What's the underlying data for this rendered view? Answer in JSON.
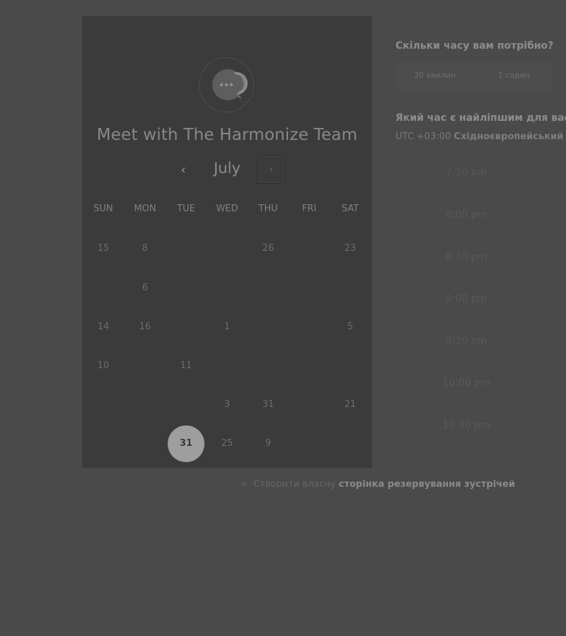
{
  "card": {
    "title": "Meet with The Harmonize Team",
    "month": "July",
    "prev_icon": "‹",
    "next_icon": "›"
  },
  "weekdays": [
    "SUN",
    "MON",
    "TUE",
    "WED",
    "THU",
    "FRI",
    "SAT"
  ],
  "calendar_rows": [
    [
      "15",
      "8",
      "",
      "",
      "26",
      "",
      "23"
    ],
    [
      "",
      "6",
      "",
      "",
      "",
      "",
      ""
    ],
    [
      "14",
      "16",
      "",
      "1",
      "",
      "",
      "5"
    ],
    [
      "10",
      "",
      "11",
      "",
      "",
      "",
      ""
    ],
    [
      "",
      "",
      "",
      "3",
      "31",
      "",
      "21"
    ],
    [
      "",
      "",
      "31",
      "25",
      "9",
      "",
      ""
    ]
  ],
  "selected_day": "31",
  "booking": {
    "duration_question": "Скільки часу вам потрібно?",
    "durations": [
      "30 хвилин",
      "1 годин"
    ],
    "time_question": "Який час є найліпшим для вас?",
    "timezone_offset": "UTC +03:00",
    "timezone_name": "Східноєвропейський час",
    "slots": [
      "7:30 pm",
      "8:00 pm",
      "8:30 pm",
      "9:00 pm",
      "9:30 pm",
      "10:00 pm",
      "10:30 pm"
    ]
  },
  "footer": {
    "prefix": "Створити власну",
    "link": "сторінка резервування зустрічей"
  },
  "icons": {
    "logo": "chat-bubble-logo-icon",
    "footer": "wand-icon"
  },
  "colors": {
    "background": "#4a4a4a",
    "card": "#3b3b3b",
    "selected_day": "#9e9e9e"
  }
}
